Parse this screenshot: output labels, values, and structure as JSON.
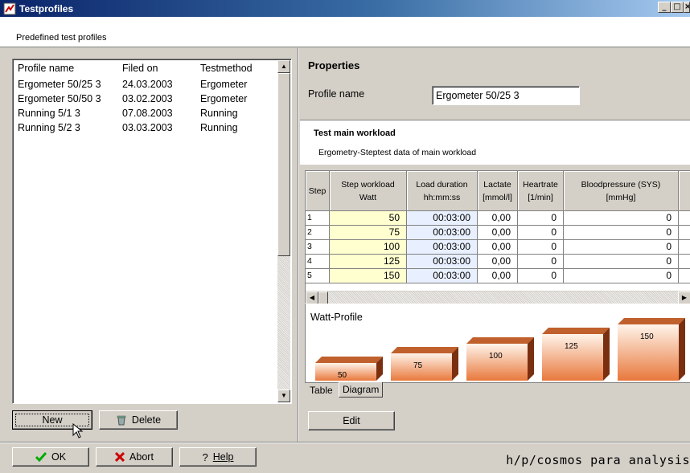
{
  "window": {
    "title": "Testprofiles",
    "controls": [
      "_",
      "□",
      "×"
    ]
  },
  "subheader": {
    "text": "Predefined test profiles"
  },
  "list": {
    "headers": [
      "Profile name",
      "Filed on",
      "Testmethod"
    ],
    "rows": [
      [
        "Ergometer 50/25 3",
        "24.03.2003",
        "Ergometer"
      ],
      [
        "Ergometer 50/50 3",
        "03.02.2003",
        "Ergometer"
      ],
      [
        "Running 5/1 3",
        "07.08.2003",
        "Running"
      ],
      [
        "Running 5/2 3",
        "03.03.2003",
        "Running"
      ]
    ]
  },
  "left_buttons": {
    "new": "New",
    "delete": "Delete"
  },
  "properties": {
    "title": "Properties",
    "profile_name_label": "Profile name",
    "profile_name_value": "Ergometer 50/25 3"
  },
  "workload": {
    "title": "Test main workload",
    "subtitle": "Ergometry-Steptest data of main workload"
  },
  "table": {
    "headers": [
      [
        "Step",
        ""
      ],
      [
        "Step workload",
        "Watt"
      ],
      [
        "Load duration",
        "hh:mm:ss"
      ],
      [
        "Lactate",
        "[mmol/l]"
      ],
      [
        "Heartrate",
        "[1/min]"
      ],
      [
        "Bloodpressure (SYS)",
        "[mmHg]"
      ]
    ],
    "rows": [
      [
        "1",
        "50",
        "00:03:00",
        "0,00",
        "0",
        "0"
      ],
      [
        "2",
        "75",
        "00:03:00",
        "0,00",
        "0",
        "0"
      ],
      [
        "3",
        "100",
        "00:03:00",
        "0,00",
        "0",
        "0"
      ],
      [
        "4",
        "125",
        "00:03:00",
        "0,00",
        "0",
        "0"
      ],
      [
        "5",
        "150",
        "00:03:00",
        "0,00",
        "0",
        "0"
      ]
    ]
  },
  "diagram": {
    "title": "Watt-Profile",
    "values": [
      "50",
      "75",
      "100",
      "125",
      "150"
    ],
    "bar_color": "#e8783c"
  },
  "tabs": [
    "Table",
    "Diagram"
  ],
  "edit_button": "Edit",
  "bottom": {
    "ok": "OK",
    "abort": "Abort",
    "help": "Help",
    "brand": "h/p/cosmos para analysis"
  }
}
